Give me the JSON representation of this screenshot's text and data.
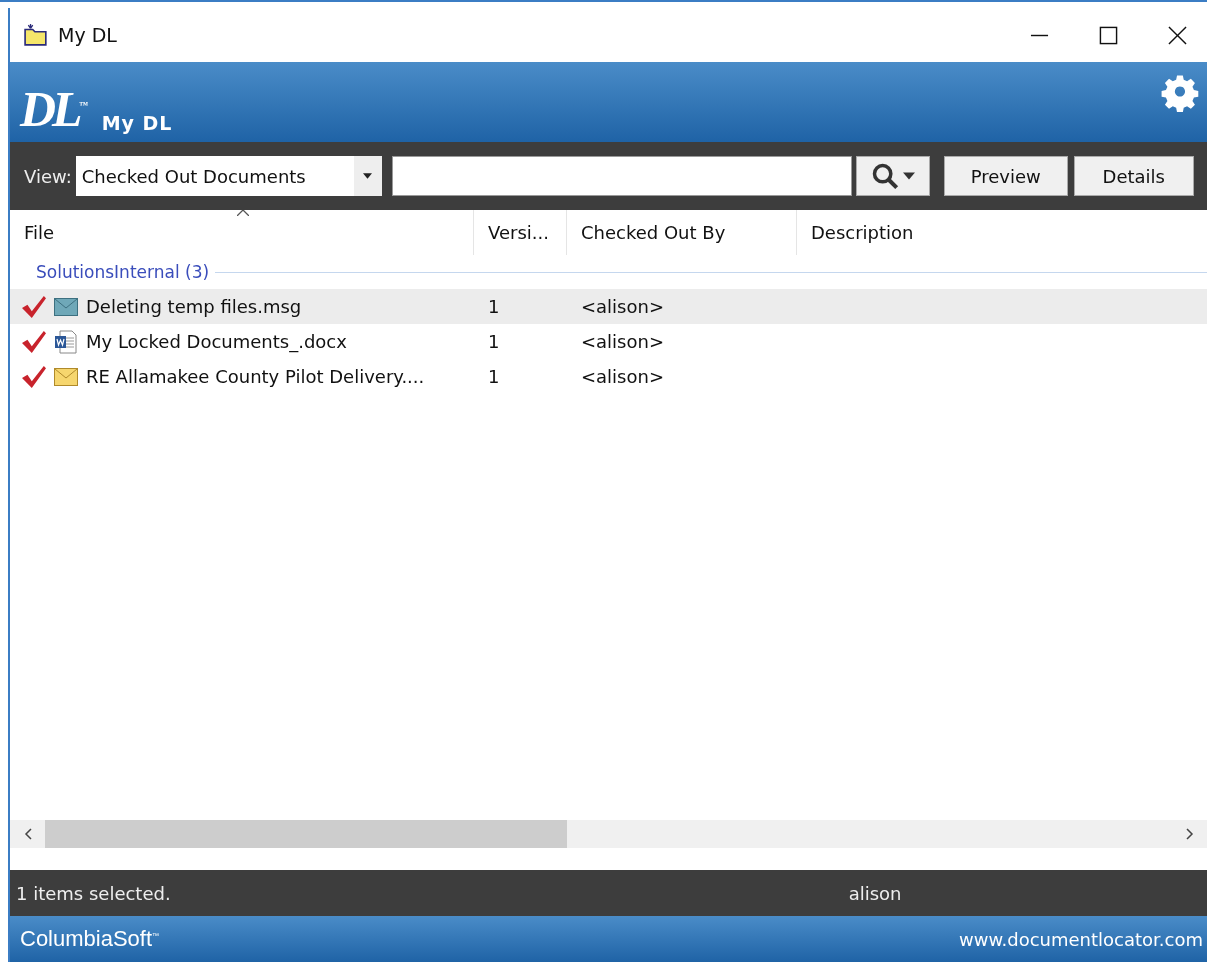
{
  "window": {
    "title": "My DL"
  },
  "header": {
    "logo": "DL$^{™}$",
    "title": "My DL"
  },
  "toolbar": {
    "view_label": "View:",
    "view_value": "Checked Out Documents",
    "buttons": [
      "Preview",
      "Details"
    ]
  },
  "table": {
    "columns": [
      {
        "label": "File",
        "sorted": true
      },
      {
        "label": "Versi...",
        "sorted": false
      },
      {
        "label": "Checked Out By",
        "sorted": false
      },
      {
        "label": "Description",
        "sorted": false
      }
    ],
    "group": "SolutionsInternal (3)",
    "rows": [
      {
        "kind": "message",
        "checked_out": true,
        "selected": true,
        "file": "Deleting temp files.msg",
        "version": "1",
        "checked_out_by": "<alison>"
      },
      {
        "kind": "word",
        "checked_out": true,
        "selected": false,
        "file": "My Locked Documents_.docx",
        "version": "1",
        "checked_out_by": "<alison>"
      },
      {
        "kind": "mail",
        "checked_out": true,
        "selected": false,
        "file": "RE Allamakee County Pilot Delivery....",
        "version": "1",
        "checked_out_by": "<alison>"
      }
    ]
  },
  "status_bar": {
    "message": "1 items selected.",
    "user": "alison"
  },
  "footer": {
    "brand": "ColumbiaSoft$^{™}$",
    "url": "www.documentlocator.com"
  }
}
